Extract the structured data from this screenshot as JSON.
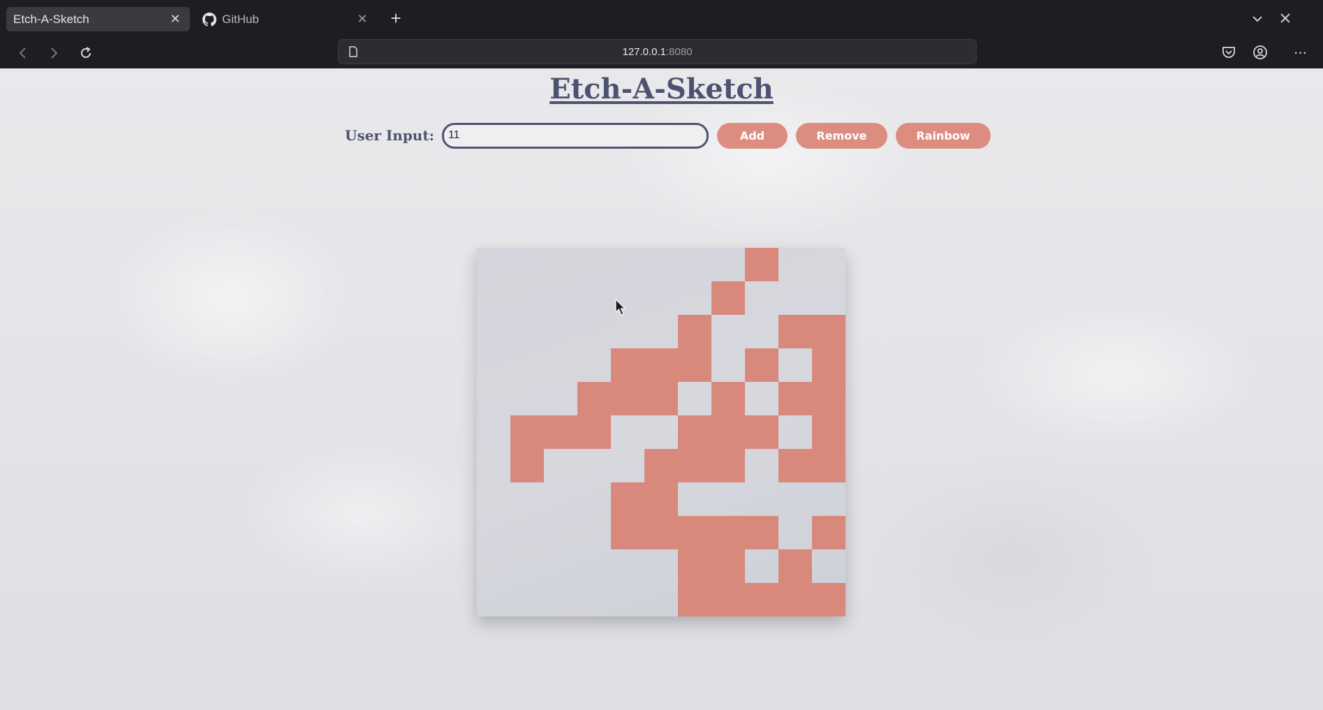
{
  "browser": {
    "tabs": [
      {
        "title": "Etch-A-Sketch",
        "active": true
      },
      {
        "title": "GitHub",
        "active": false,
        "icon": "github-icon"
      }
    ],
    "url_host": "127.0.0.1",
    "url_port": ":8080"
  },
  "page": {
    "title": "Etch-A-Sketch",
    "input_label": "User Input:",
    "input_value": "11",
    "buttons": {
      "add": "Add",
      "remove": "Remove",
      "rainbow": "Rainbow"
    }
  },
  "grid": {
    "size": 11,
    "fill_color": "#d8897c",
    "rows": [
      "00000000100",
      "00000001000",
      "00000010011",
      "00001110101",
      "00011101011",
      "01110011101",
      "01000111011",
      "00001100000",
      "00001111101",
      "00000011010",
      "00000011111"
    ]
  },
  "colors": {
    "accent": "#dc8d7f",
    "text": "#4d5270"
  }
}
